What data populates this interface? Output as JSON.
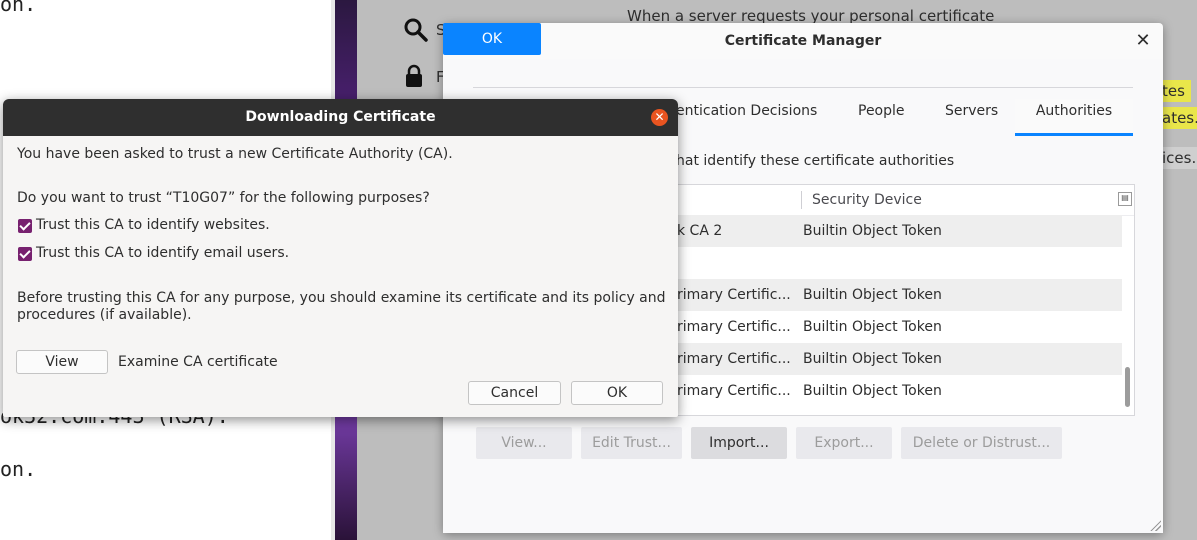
{
  "terminal": {
    "lines": [
      "on.",
      "ok32.com:443 (RSA).",
      "on."
    ]
  },
  "prefs_bg": {
    "search_letter": "S",
    "lock_letter": "F",
    "top_text": "When a server requests your personal certificate",
    "highlights": [
      "tes",
      "ates.",
      "ices."
    ]
  },
  "cert_manager": {
    "title": "Certificate Manager",
    "tabs": [
      {
        "label": "entication Decisions"
      },
      {
        "label": "People"
      },
      {
        "label": "Servers"
      },
      {
        "label": "Authorities",
        "selected": true
      }
    ],
    "description": "hat identify these certificate authorities",
    "columns": {
      "device": "Security Device"
    },
    "rows": [
      {
        "name": "k CA 2",
        "device": "Builtin Object Token"
      },
      {
        "name": "",
        "device": ""
      },
      {
        "name": "rimary Certific...",
        "device": "Builtin Object Token"
      },
      {
        "name": "rimary Certific...",
        "device": "Builtin Object Token"
      },
      {
        "name": "rimary Certific...",
        "device": "Builtin Object Token"
      },
      {
        "name": "rimary Certific...",
        "device": "Builtin Object Token"
      }
    ],
    "buttons": {
      "view": "View...",
      "edit_trust": "Edit Trust...",
      "import": "Import...",
      "export": "Export...",
      "delete": "Delete or Distrust...",
      "ok": "OK"
    }
  },
  "download_dialog": {
    "title": "Downloading Certificate",
    "intro": "You have been asked to trust a new Certificate Authority (CA).",
    "question": "Do you want to trust “T10G07” for the following purposes?",
    "check_websites": "Trust this CA to identify websites.",
    "check_email": "Trust this CA to identify email users.",
    "warning_line1": "Before trusting this CA for any purpose, you should examine its certificate and its policy and",
    "warning_line2": "procedures (if available).",
    "view_button": "View",
    "examine_label": "Examine CA certificate",
    "cancel": "Cancel",
    "ok": "OK"
  },
  "colors": {
    "accent_blue": "#0a84ff",
    "checkbox_purple": "#77216f",
    "close_orange": "#e95420",
    "highlight_yellow": "#e9e64a"
  }
}
